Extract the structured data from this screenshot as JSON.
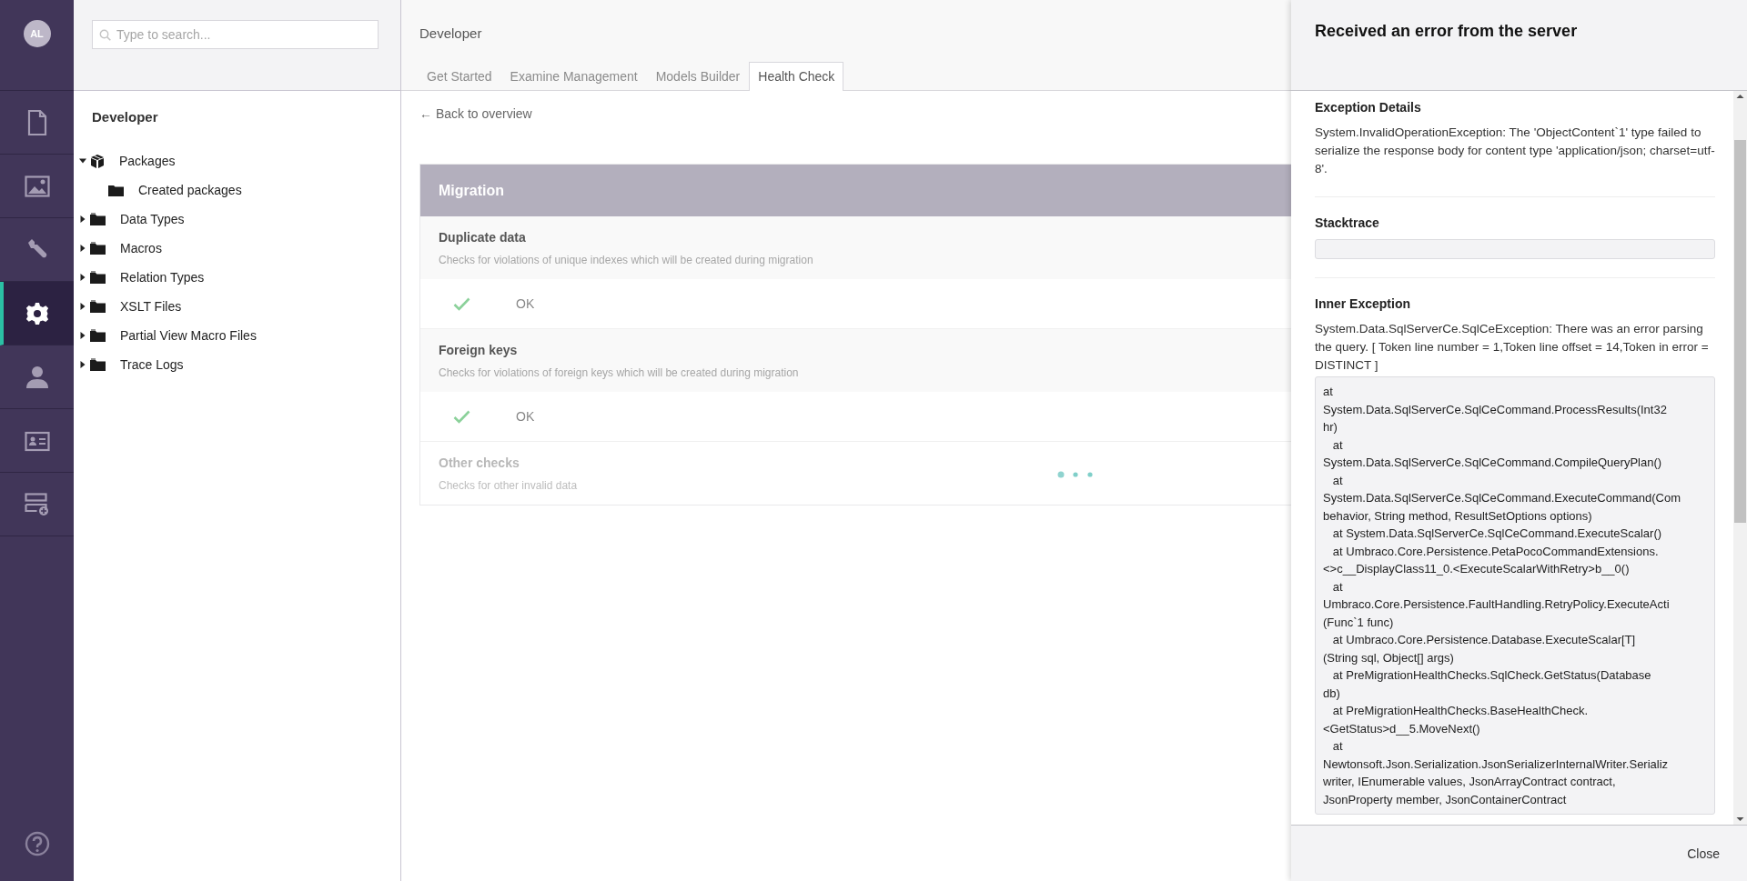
{
  "nav": {
    "avatar": "AL",
    "items": [
      {
        "kind": "document",
        "selected": false
      },
      {
        "kind": "media",
        "selected": false
      },
      {
        "kind": "wrench",
        "selected": false
      },
      {
        "kind": "gear",
        "selected": true
      },
      {
        "kind": "person",
        "selected": false
      },
      {
        "kind": "card",
        "selected": false
      },
      {
        "kind": "form",
        "selected": false
      }
    ]
  },
  "tree": {
    "search": {
      "placeholder": "Type to search..."
    },
    "title": "Developer",
    "items": [
      {
        "label": "Packages",
        "kind": "package",
        "expanded": true,
        "children": [
          {
            "label": "Created packages",
            "kind": "folder"
          }
        ]
      },
      {
        "label": "Data Types",
        "kind": "folder",
        "expanded": false
      },
      {
        "label": "Macros",
        "kind": "folder",
        "expanded": false
      },
      {
        "label": "Relation Types",
        "kind": "folder",
        "expanded": false
      },
      {
        "label": "XSLT Files",
        "kind": "folder",
        "expanded": false
      },
      {
        "label": "Partial View Macro Files",
        "kind": "folder",
        "expanded": false
      },
      {
        "label": "Trace Logs",
        "kind": "folder",
        "expanded": false
      }
    ]
  },
  "main": {
    "title": "Developer",
    "tabs": [
      {
        "label": "Get Started",
        "selected": false
      },
      {
        "label": "Examine Management",
        "selected": false
      },
      {
        "label": "Models Builder",
        "selected": false
      },
      {
        "label": "Health Check",
        "selected": true
      }
    ],
    "back_link": "← Back to overview",
    "group": {
      "title": "Migration",
      "checks": [
        {
          "title": "Duplicate data",
          "description": "Checks for violations of unique indexes which will be created during migration",
          "loading": false,
          "result": "OK"
        },
        {
          "title": "Foreign keys",
          "description": "Checks for violations of foreign keys which will be created during migration",
          "loading": false,
          "result": "OK"
        },
        {
          "title": "Other checks",
          "description": "Checks for other invalid data",
          "loading": true
        }
      ]
    }
  },
  "error_panel": {
    "title": "Received an error from the server",
    "sections": [
      {
        "heading": "Exception Details",
        "text": "System.InvalidOperationException: The 'ObjectContent`1' type failed to serialize the response body for content type 'application/json; charset=utf-8'."
      },
      {
        "heading": "Stacktrace",
        "kind": "empty-box"
      },
      {
        "heading": "Inner Exception",
        "text": "System.Data.SqlServerCe.SqlCeException: There was an error parsing the query. [ Token line number = 1,Token line offset = 14,Token in error = DISTINCT ]",
        "trace": [
          "at",
          "System.Data.SqlServerCe.SqlCeCommand.ProcessResults(Int32",
          "hr)",
          "   at",
          "System.Data.SqlServerCe.SqlCeCommand.CompileQueryPlan()",
          "   at",
          "System.Data.SqlServerCe.SqlCeCommand.ExecuteCommand(Com",
          "behavior, String method, ResultSetOptions options)",
          "   at System.Data.SqlServerCe.SqlCeCommand.ExecuteScalar()",
          "   at Umbraco.Core.Persistence.PetaPocoCommandExtensions.",
          "<>c__DisplayClass11_0.<ExecuteScalarWithRetry>b__0()",
          "   at",
          "Umbraco.Core.Persistence.FaultHandling.RetryPolicy.ExecuteActi",
          "(Func`1 func)",
          "   at Umbraco.Core.Persistence.Database.ExecuteScalar[T]",
          "(String sql, Object[] args)",
          "   at PreMigrationHealthChecks.SqlCheck.GetStatus(Database",
          "db)",
          "   at PreMigrationHealthChecks.BaseHealthCheck.",
          "<GetStatus>d__5.MoveNext()",
          "   at",
          "Newtonsoft.Json.Serialization.JsonSerializerInternalWriter.Serializ",
          "writer, IEnumerable values, JsonArrayContract contract,",
          "JsonProperty member, JsonContainerContract"
        ]
      }
    ],
    "close_button": "Close"
  }
}
